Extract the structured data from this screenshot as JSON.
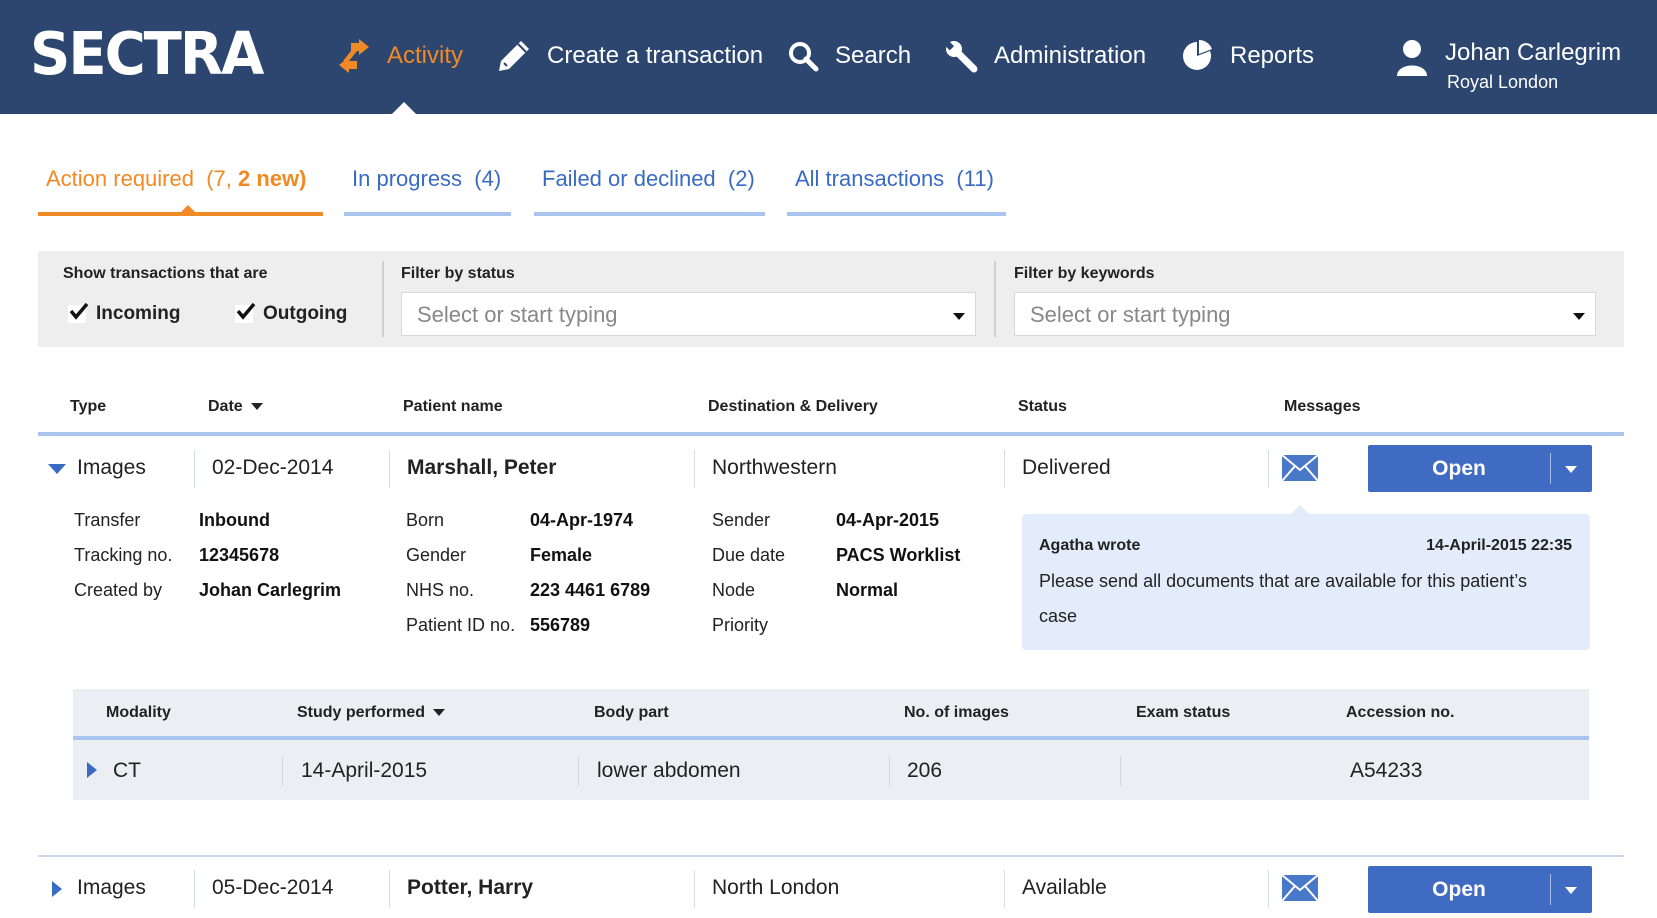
{
  "header": {
    "logo": "SECTRA",
    "nav": [
      {
        "label": "Activity",
        "icon": "arrows-swap-icon"
      },
      {
        "label": "Create a transaction",
        "icon": "pencil-icon"
      },
      {
        "label": "Search",
        "icon": "search-icon"
      },
      {
        "label": "Administration",
        "icon": "wrench-icon"
      },
      {
        "label": "Reports",
        "icon": "pie-chart-icon"
      }
    ],
    "user": {
      "name": "Johan Carlegrim",
      "org": "Royal London",
      "icon": "user-icon"
    }
  },
  "tabs": [
    {
      "label": "Action required",
      "count": "(7,",
      "new": "2 new)"
    },
    {
      "label": "In progress",
      "count": "(4)"
    },
    {
      "label": "Failed or declined",
      "count": "(2)"
    },
    {
      "label": "All transactions",
      "count": "(11)"
    }
  ],
  "filters": {
    "show_label": "Show transactions that are",
    "incoming": "Incoming",
    "outgoing": "Outgoing",
    "incoming_checked": true,
    "outgoing_checked": true,
    "status_label": "Filter by status",
    "status_placeholder": "Select or start typing",
    "keywords_label": "Filter by keywords",
    "keywords_placeholder": "Select or start typing"
  },
  "columns": [
    "Type",
    "Date",
    "Patient name",
    "Destination & Delivery",
    "Status",
    "Messages"
  ],
  "rows": [
    {
      "type": "Images",
      "date": "02-Dec-2014",
      "patient": "Marshall, Peter",
      "destination": "Northwestern",
      "status": "Delivered",
      "button": "Open",
      "expanded": true
    },
    {
      "type": "Images",
      "date": "05-Dec-2014",
      "patient": "Potter, Harry",
      "destination": "North London",
      "status": "Available",
      "button": "Open",
      "expanded": false
    }
  ],
  "details": {
    "transfer_label": "Transfer",
    "transfer": "Inbound",
    "tracking_label": "Tracking no.",
    "tracking": "12345678",
    "created_label": "Created by",
    "created": "Johan Carlegrim",
    "born_label": "Born",
    "born": "04-Apr-1974",
    "gender_label": "Gender",
    "gender": "Female",
    "nhs_label": "NHS no.",
    "nhs": "223 4461 6789",
    "pid_label": "Patient ID no.",
    "pid": "556789",
    "sender_label": "Sender",
    "sender": "04-Apr-2015",
    "due_label": "Due date",
    "due": "PACS Worklist",
    "node_label": "Node",
    "node": "Normal",
    "priority_label": "Priority"
  },
  "message": {
    "author": "Agatha wrote",
    "time": "14-April-2015 22:35",
    "text": "Please send all documents that are available for this patient’s case"
  },
  "study_columns": [
    "Modality",
    "Study performed",
    "Body part",
    "No. of images",
    "Exam status",
    "Accession no."
  ],
  "studies": [
    {
      "modality": "CT",
      "performed": "14-April-2015",
      "body_part": "lower abdomen",
      "images": "206",
      "exam_status": "",
      "accession": "A54233"
    }
  ],
  "colors": {
    "header_bg": "#2c4670",
    "accent": "#f08a24",
    "link": "#3a6bc4",
    "button": "#3f6bc3"
  }
}
